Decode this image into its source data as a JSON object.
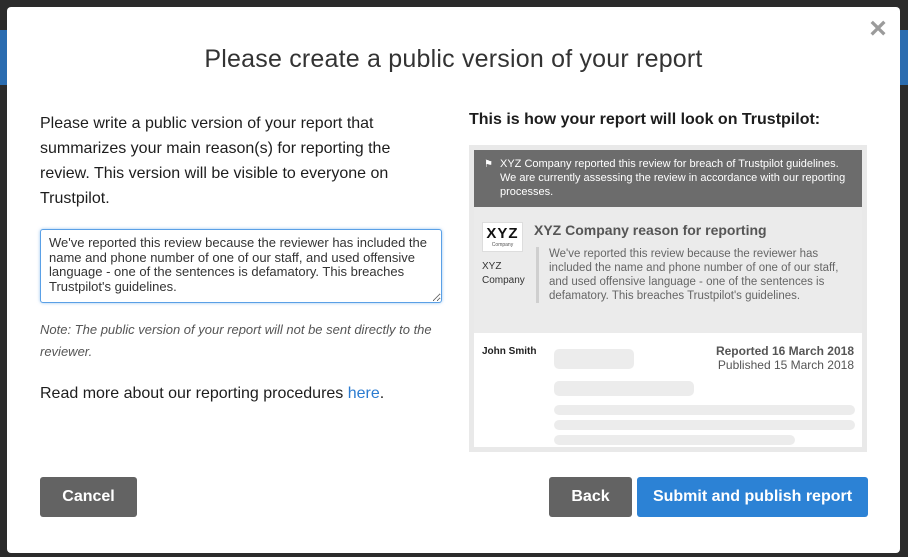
{
  "dialog": {
    "title": "Please create a public version of your report",
    "close_icon": "×"
  },
  "left": {
    "intro": "Please write a public version of your report that summarizes your main reason(s) for reporting the review. This version will be visible to everyone on Trustpilot.",
    "textarea_value": "We've reported this review because the reviewer has included the name and phone number of one of our staff, and used offensive language - one of the sentences is defamatory. This breaches Trustpilot's guidelines.",
    "note": "Note: The public version of your report will not be sent directly to the reviewer.",
    "readmore_prefix": "Read more about our reporting procedures ",
    "readmore_link": "here",
    "readmore_suffix": "."
  },
  "preview": {
    "heading": "This is how your report will look on Trustpilot:",
    "banner": "XYZ Company reported this review for breach of Trustpilot guidelines. We are currently assessing the review in accordance with our reporting processes.",
    "logo_main": "XYZ",
    "logo_sub": "Company",
    "company_name_line1": "XYZ",
    "company_name_line2": "Company",
    "reason_title": "XYZ Company reason for reporting",
    "reason_text": "We've reported this review because the reviewer has included the name and phone number of one of our staff, and used offensive language - one of the sentences is defamatory. This breaches Trustpilot's guidelines.",
    "reviewer": "John Smith",
    "reported": "Reported 16 March 2018",
    "published": "Published 15 March 2018"
  },
  "buttons": {
    "cancel": "Cancel",
    "back": "Back",
    "submit": "Submit and publish report"
  },
  "colors": {
    "primary": "#2c82d5",
    "secondary": "#636363"
  }
}
